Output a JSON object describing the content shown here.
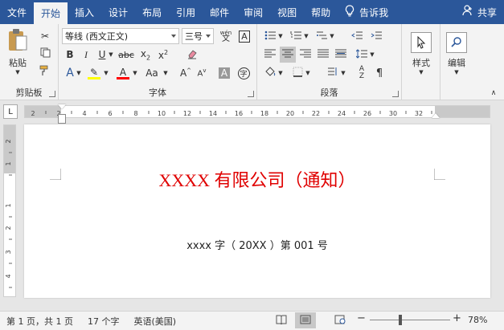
{
  "tabs": [
    {
      "label": "文件",
      "active": false
    },
    {
      "label": "开始",
      "active": true
    },
    {
      "label": "插入",
      "active": false
    },
    {
      "label": "设计",
      "active": false
    },
    {
      "label": "布局",
      "active": false
    },
    {
      "label": "引用",
      "active": false
    },
    {
      "label": "邮件",
      "active": false
    },
    {
      "label": "审阅",
      "active": false
    },
    {
      "label": "视图",
      "active": false
    },
    {
      "label": "帮助",
      "active": false
    }
  ],
  "tell_me": "告诉我",
  "share": "共享",
  "ribbon": {
    "clipboard": {
      "label": "剪贴板",
      "paste_label": "粘贴"
    },
    "font": {
      "label": "字体",
      "font_name": "等线 (西文正文)",
      "font_size": "三号",
      "pinyin_top": "wén",
      "pinyin_char": "文"
    },
    "paragraph": {
      "label": "段落"
    },
    "styles": {
      "label": "样式"
    },
    "editing": {
      "label": "编辑"
    }
  },
  "ruler": {
    "corner": "L",
    "h_ticks": [
      "2",
      "2",
      "4",
      "6",
      "8",
      "10",
      "12",
      "14",
      "16",
      "18",
      "20",
      "22",
      "24",
      "26",
      "30",
      "32"
    ],
    "v_ticks": [
      "2",
      "1",
      "1",
      "2",
      "3",
      "4"
    ]
  },
  "document": {
    "title": "XXXX 有限公司（通知）",
    "doc_number": "xxxx 字（ 20XX ）第 001 号"
  },
  "status": {
    "page": "第 1 页，共 1 页",
    "words": "17 个字",
    "language": "英语(美国)",
    "zoom_percent": "78%",
    "zoom_value": 78
  },
  "colors": {
    "brand": "#2b579a",
    "title_red": "#e00000",
    "highlight_yellow": "#ffff00",
    "font_red": "#ff0000"
  }
}
